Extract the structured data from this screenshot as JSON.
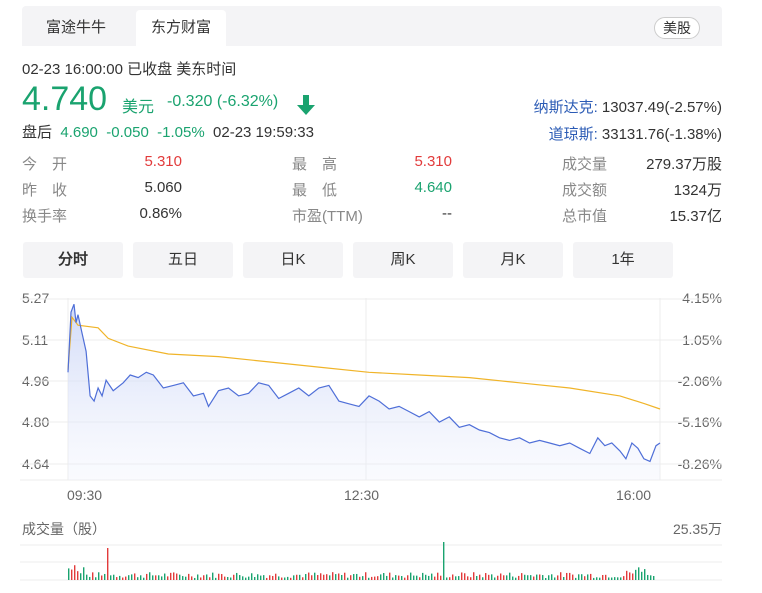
{
  "tabs": [
    "富途牛牛",
    "东方财富"
  ],
  "market_badge": "美股",
  "status_line": "02-23 16:00:00  已收盘  美东时间",
  "price": "4.740",
  "unit": "美元",
  "change": "-0.320 (-6.32%)",
  "indices": [
    {
      "name": "纳斯达克:",
      "value": "13037.49(-2.57%)"
    },
    {
      "name": "道琼斯:",
      "value": "33131.76(-1.38%)"
    }
  ],
  "after_hours": {
    "label": "盘后",
    "price": "4.690",
    "change": "-0.050",
    "pct": "-1.05%",
    "time": "02-23 19:59:33"
  },
  "stats": {
    "open": {
      "label": "今　开",
      "value": "5.310"
    },
    "prev_close": {
      "label": "昨　收",
      "value": "5.060"
    },
    "turnover_rate": {
      "label": "换手率",
      "value": "0.86%"
    },
    "high": {
      "label": "最　高",
      "value": "5.310"
    },
    "low": {
      "label": "最　低",
      "value": "4.640"
    },
    "pe": {
      "label": "市盈(TTM)",
      "value": "--"
    },
    "volume": {
      "label": "成交量",
      "value": "279.37万股"
    },
    "amount": {
      "label": "成交额",
      "value": "1324万"
    },
    "market_cap": {
      "label": "总市值",
      "value": "15.37亿"
    }
  },
  "period_tabs": [
    "分时",
    "五日",
    "日K",
    "周K",
    "月K",
    "1年"
  ],
  "chart_data": {
    "type": "line",
    "y_left_ticks": [
      "5.27",
      "5.11",
      "4.96",
      "4.80",
      "4.64"
    ],
    "y_right_ticks": [
      "4.15%",
      "1.05%",
      "-2.06%",
      "-5.16%",
      "-8.26%"
    ],
    "x_ticks": [
      "09:30",
      "12:30",
      "16:00"
    ],
    "ylim": [
      4.64,
      5.27
    ],
    "prev_close": 5.06,
    "series": [
      {
        "name": "price",
        "color": "#4f6fd8",
        "points": [
          [
            0,
            4.99
          ],
          [
            3,
            5.22
          ],
          [
            6,
            5.25
          ],
          [
            8,
            5.18
          ],
          [
            10,
            5.21
          ],
          [
            14,
            5.14
          ],
          [
            18,
            5.07
          ],
          [
            22,
            4.9
          ],
          [
            26,
            4.88
          ],
          [
            30,
            4.93
          ],
          [
            34,
            4.9
          ],
          [
            38,
            4.96
          ],
          [
            45,
            4.92
          ],
          [
            55,
            4.95
          ],
          [
            62,
            4.98
          ],
          [
            70,
            4.97
          ],
          [
            78,
            4.99
          ],
          [
            85,
            4.98
          ],
          [
            95,
            4.93
          ],
          [
            105,
            4.94
          ],
          [
            115,
            4.95
          ],
          [
            125,
            4.9
          ],
          [
            135,
            4.91
          ],
          [
            140,
            4.86
          ],
          [
            150,
            4.92
          ],
          [
            160,
            4.93
          ],
          [
            170,
            4.9
          ],
          [
            180,
            4.91
          ],
          [
            190,
            4.95
          ],
          [
            200,
            4.94
          ],
          [
            210,
            4.89
          ],
          [
            220,
            4.91
          ],
          [
            230,
            4.93
          ],
          [
            240,
            4.9
          ],
          [
            250,
            4.93
          ],
          [
            260,
            4.94
          ],
          [
            270,
            4.88
          ],
          [
            280,
            4.87
          ],
          [
            290,
            4.86
          ],
          [
            300,
            4.9
          ],
          [
            310,
            4.88
          ],
          [
            320,
            4.85
          ],
          [
            330,
            4.86
          ],
          [
            340,
            4.84
          ],
          [
            350,
            4.82
          ],
          [
            360,
            4.84
          ],
          [
            370,
            4.8
          ],
          [
            380,
            4.82
          ],
          [
            390,
            4.78
          ],
          [
            400,
            4.79
          ],
          [
            410,
            4.77
          ],
          [
            420,
            4.76
          ],
          [
            430,
            4.74
          ],
          [
            440,
            4.73
          ],
          [
            450,
            4.74
          ],
          [
            460,
            4.72
          ],
          [
            470,
            4.73
          ],
          [
            480,
            4.72
          ],
          [
            490,
            4.71
          ],
          [
            500,
            4.72
          ],
          [
            510,
            4.7
          ],
          [
            520,
            4.68
          ],
          [
            528,
            4.74
          ],
          [
            535,
            4.71
          ],
          [
            542,
            4.72
          ],
          [
            550,
            4.69
          ],
          [
            556,
            4.66
          ],
          [
            562,
            4.72
          ],
          [
            568,
            4.7
          ],
          [
            574,
            4.66
          ],
          [
            580,
            4.65
          ],
          [
            586,
            4.71
          ],
          [
            590,
            4.72
          ]
        ]
      },
      {
        "name": "avg",
        "color": "#f0b429",
        "points": [
          [
            0,
            5.0
          ],
          [
            4,
            5.2
          ],
          [
            10,
            5.17
          ],
          [
            30,
            5.16
          ],
          [
            40,
            5.12
          ],
          [
            60,
            5.09
          ],
          [
            100,
            5.06
          ],
          [
            150,
            5.05
          ],
          [
            200,
            5.03
          ],
          [
            250,
            5.01
          ],
          [
            300,
            4.99
          ],
          [
            350,
            4.98
          ],
          [
            400,
            4.97
          ],
          [
            450,
            4.95
          ],
          [
            500,
            4.93
          ],
          [
            550,
            4.9
          ],
          [
            575,
            4.87
          ],
          [
            590,
            4.85
          ]
        ]
      }
    ],
    "volume_label": "成交量（股）",
    "volume_max": "25.35万"
  },
  "colors": {
    "up": "#e23b3b",
    "down": "#1aa36f",
    "price_line": "#4f6fd8",
    "avg_line": "#f0b429"
  }
}
